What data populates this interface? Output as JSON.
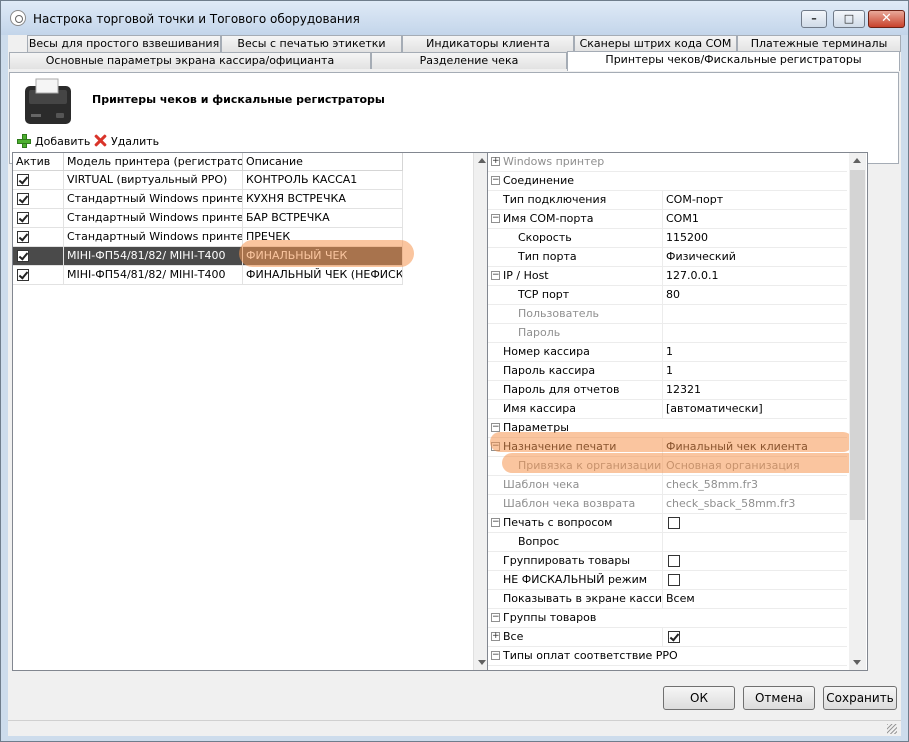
{
  "window": {
    "title": "Настрока торговой точки и Тогового оборудования"
  },
  "tabs": {
    "row1": [
      "Весы для простого взвешивания",
      "Весы с печатью этикетки",
      "Индикаторы клиента",
      "Сканеры штрих кода COM",
      "Платежные терминалы"
    ],
    "row2": [
      "Основные параметры экрана кассира/официанта",
      "Разделение чека",
      "Принтеры чеков/Фискальные регистраторы"
    ],
    "active": "Принтеры чеков/Фискальные регистраторы"
  },
  "page": {
    "heading": "Принтеры чеков и фискальные регистраторы"
  },
  "toolbar": {
    "add_label": "Добавить",
    "delete_label": "Удалить"
  },
  "printers": {
    "columns": [
      "Актив",
      "Модель принтера (регистратора)",
      "Описание"
    ],
    "rows": [
      {
        "active": true,
        "model": "VIRTUAL (виртуальный РРО)",
        "description": "КОНТРОЛЬ КАССА1"
      },
      {
        "active": true,
        "model": "Стандартный Windows принтер",
        "description": "КУХНЯ ВСТРЕЧКА"
      },
      {
        "active": true,
        "model": "Стандартный Windows принтер",
        "description": "БАР ВСТРЕЧКА"
      },
      {
        "active": true,
        "model": "Стандартный Windows принтер",
        "description": "ПРЕЧЕК"
      },
      {
        "active": true,
        "model": "МІНІ-ФП54/81/82/  МІНІ-Т400",
        "description": "ФИНАЛЬНЫЙ ЧЕК",
        "selected": true
      },
      {
        "active": true,
        "model": "МІНІ-ФП54/81/82/  МІНІ-Т400",
        "description": "ФИНАЛЬНЫЙ ЧЕК (НЕФИСК)"
      }
    ]
  },
  "properties": {
    "rows": [
      {
        "name": "Windows принтер",
        "kind": "cat",
        "expander": "plus",
        "disabled": true
      },
      {
        "name": "Соединение",
        "kind": "cat",
        "expander": "minus"
      },
      {
        "name": "Тип подключения",
        "value": "COM-порт",
        "indent": 1
      },
      {
        "name": "Имя COM-порта",
        "value": "COM1",
        "indent": 1,
        "expander": "minus"
      },
      {
        "name": "Скорость",
        "value": "115200",
        "indent": 2
      },
      {
        "name": "Тип порта",
        "value": "Физический",
        "indent": 2
      },
      {
        "name": "IP / Host",
        "value": "127.0.0.1",
        "indent": 1,
        "expander": "minus"
      },
      {
        "name": "TCP порт",
        "value": "80",
        "indent": 2
      },
      {
        "name": "Пользователь",
        "value": "",
        "indent": 2,
        "disabled": true
      },
      {
        "name": "Пароль",
        "value": "",
        "indent": 2,
        "disabled": true
      },
      {
        "name": "Номер кассира",
        "value": "1",
        "indent": 1
      },
      {
        "name": "Пароль кассира",
        "value": "1",
        "indent": 1
      },
      {
        "name": "Пароль для отчетов",
        "value": "12321",
        "indent": 1
      },
      {
        "name": "Имя кассира",
        "value": "[автоматически]",
        "indent": 1
      },
      {
        "name": "Параметры",
        "kind": "cat",
        "expander": "minus"
      },
      {
        "name": "Назначение печати",
        "value": "Финальный чек клиента",
        "indent": 1,
        "expander": "minus"
      },
      {
        "name": "Привязка к организации",
        "value": "Основная организация",
        "indent": 2,
        "disabled": true
      },
      {
        "name": "Шаблон чека",
        "value": "check_58mm.fr3",
        "indent": 1,
        "disabled": true
      },
      {
        "name": "Шаблон чека возврата",
        "value": "check_sback_58mm.fr3",
        "indent": 1,
        "disabled": true
      },
      {
        "name": "Печать с вопросом",
        "value": "",
        "checkbox": false,
        "indent": 1,
        "expander": "minus"
      },
      {
        "name": "Вопрос",
        "value": "",
        "indent": 2
      },
      {
        "name": "Группировать товары",
        "value": "",
        "checkbox": false,
        "indent": 1
      },
      {
        "name": "НЕ ФИСКАЛЬНЫЙ режим",
        "value": "",
        "checkbox": false,
        "indent": 1
      },
      {
        "name": "Показывать в экране кассира/",
        "value": "Всем",
        "indent": 1
      },
      {
        "name": "Группы товаров",
        "kind": "cat",
        "expander": "minus"
      },
      {
        "name": "Все",
        "value": "",
        "checkbox": true,
        "indent": 1,
        "expander": "plus"
      },
      {
        "name": "Типы оплат соответствие РРО",
        "kind": "cat",
        "expander": "minus"
      }
    ]
  },
  "buttons": {
    "ok": "ОК",
    "cancel": "Отмена",
    "save": "Сохранить"
  },
  "colors": {
    "selection": "#4a4a4a",
    "highlight": "#f59650"
  }
}
